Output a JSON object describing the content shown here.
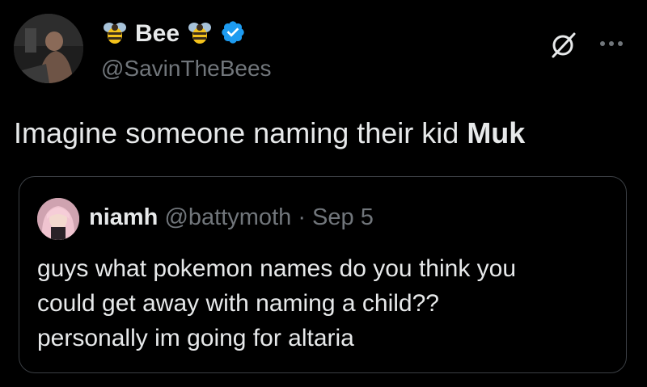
{
  "author": {
    "name": "Bee",
    "handle": "@SavinTheBees",
    "verified": true,
    "icons": [
      "bee-emoji",
      "bee-emoji",
      "verified-badge-icon"
    ]
  },
  "tweet": {
    "text_prefix": "Imagine someone naming their kid ",
    "text_bold": "Muk"
  },
  "quote": {
    "author_name": "niamh",
    "author_handle": "@battymoth",
    "separator": "·",
    "date": "Sep 5",
    "body_lines": [
      "guys what pokemon names do you think you",
      "could get away with naming a child??",
      "personally im going for altaria"
    ]
  },
  "colors": {
    "background": "#000000",
    "text": "#e7e9ea",
    "secondary": "#71767b",
    "verified": "#1d9bf0",
    "border": "#3b3f44"
  }
}
